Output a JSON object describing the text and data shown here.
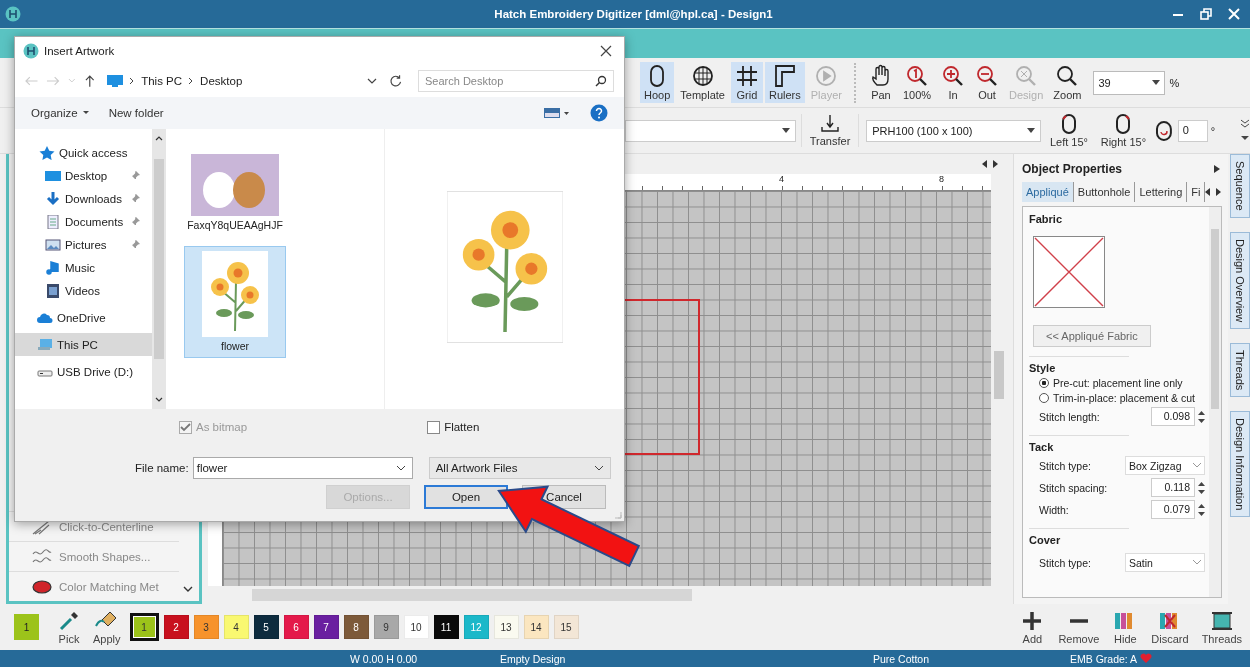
{
  "window": {
    "title": "Hatch Embroidery Digitizer [dml@hpl.ca] - Design1"
  },
  "toolbar": {
    "items": [
      {
        "kind": "hoop",
        "label": "Hoop",
        "selected": true,
        "disabled": false
      },
      {
        "kind": "template",
        "label": "Template",
        "selected": false,
        "disabled": false
      },
      {
        "kind": "grid",
        "label": "Grid",
        "selected": true,
        "disabled": false
      },
      {
        "kind": "rulers",
        "label": "Rulers",
        "selected": true,
        "disabled": false
      },
      {
        "kind": "player",
        "label": "Player",
        "selected": false,
        "disabled": true
      },
      {
        "kind": "pan",
        "label": "Pan",
        "selected": false,
        "disabled": false
      },
      {
        "kind": "zoom100",
        "label": "100%",
        "selected": false,
        "disabled": false
      },
      {
        "kind": "zoomin",
        "label": "In",
        "selected": false,
        "disabled": false
      },
      {
        "kind": "zoomout",
        "label": "Out",
        "selected": false,
        "disabled": false
      },
      {
        "kind": "zoomdesign",
        "label": "Design",
        "selected": false,
        "disabled": true
      },
      {
        "kind": "zoom",
        "label": "Zoom",
        "selected": false,
        "disabled": false
      }
    ],
    "zoom_value": "39",
    "zoom_unit": "%"
  },
  "hoop_bar": {
    "transfer": "Transfer",
    "hoop_size": "PRH100 (100 x 100)",
    "rotate_left": "Left 15°",
    "rotate_right": "Right 15°",
    "angle": "0",
    "angle_unit": "°"
  },
  "canvas": {
    "ruler_labels": [
      "4",
      "8"
    ]
  },
  "left_panel": {
    "items": [
      {
        "kind": "centerline",
        "label": "Click-to-Centerline"
      },
      {
        "kind": "smooth",
        "label": "Smooth Shapes..."
      },
      {
        "kind": "color",
        "label": "Color Matching Met"
      }
    ]
  },
  "object_properties": {
    "title": "Object Properties",
    "tabs": [
      {
        "label": "Appliqué",
        "selected": true
      },
      {
        "label": "Buttonhole",
        "selected": false
      },
      {
        "label": "Lettering",
        "selected": false
      },
      {
        "label": "Fi",
        "selected": false
      }
    ],
    "fabric": {
      "heading": "Fabric",
      "button": "<< Appliqué Fabric"
    },
    "style": {
      "heading": "Style",
      "options": [
        {
          "label": "Pre-cut: placement line only",
          "selected": true
        },
        {
          "label": "Trim-in-place: placement & cut",
          "selected": false
        }
      ],
      "stitch_length": {
        "label": "Stitch length:",
        "value": "0.098"
      }
    },
    "tack": {
      "heading": "Tack",
      "stitch_type": {
        "label": "Stitch type:",
        "value": "Box Zigzag"
      },
      "stitch_spacing": {
        "label": "Stitch spacing:",
        "value": "0.118"
      },
      "width": {
        "label": "Width:",
        "value": "0.079"
      }
    },
    "cover": {
      "heading": "Cover",
      "stitch_type": {
        "label": "Stitch type:",
        "value": "Satin"
      }
    }
  },
  "side_tabs": [
    "Sequence",
    "Design Overview",
    "Threads",
    "Design Information"
  ],
  "palette": {
    "current": {
      "label": "1",
      "color": "#9cc31a"
    },
    "tools": [
      "Pick",
      "Apply"
    ],
    "swatches": [
      {
        "label": "1",
        "color": "#9cc31a",
        "selected": true
      },
      {
        "label": "2",
        "color": "#c8101e",
        "selected": false
      },
      {
        "label": "3",
        "color": "#f7932b",
        "selected": false
      },
      {
        "label": "4",
        "color": "#f9f871",
        "selected": false
      },
      {
        "label": "5",
        "color": "#0d2b3e",
        "selected": false
      },
      {
        "label": "6",
        "color": "#e4194a",
        "selected": false
      },
      {
        "label": "7",
        "color": "#6a1fa0",
        "selected": false
      },
      {
        "label": "8",
        "color": "#7d5a3a",
        "selected": false
      },
      {
        "label": "9",
        "color": "#a8a8a8",
        "selected": false
      },
      {
        "label": "10",
        "color": "#ffffff",
        "selected": false
      },
      {
        "label": "11",
        "color": "#0a0a0a",
        "selected": false
      },
      {
        "label": "12",
        "color": "#1bb8c9",
        "selected": false
      },
      {
        "label": "13",
        "color": "#fafaf0",
        "selected": false
      },
      {
        "label": "14",
        "color": "#fbe6c0",
        "selected": false
      },
      {
        "label": "15",
        "color": "#f3e6d6",
        "selected": false
      }
    ],
    "thread_tools": [
      {
        "kind": "add",
        "label": "Add"
      },
      {
        "kind": "remove",
        "label": "Remove"
      },
      {
        "kind": "hide",
        "label": "Hide"
      },
      {
        "kind": "discard",
        "label": "Discard"
      },
      {
        "kind": "threads",
        "label": "Threads"
      }
    ]
  },
  "status_bar": [
    "W 0.00 H 0.00",
    "Empty Design",
    "Pure Cotton",
    "EMB Grade: A"
  ],
  "dialog": {
    "title": "Insert Artwork",
    "path": [
      "This PC",
      "Desktop"
    ],
    "search_placeholder": "Search Desktop",
    "organize": "Organize",
    "new_folder": "New folder",
    "nav": [
      {
        "kind": "star",
        "label": "Quick access",
        "pinned": false,
        "selected": false
      },
      {
        "kind": "desktop",
        "label": "Desktop",
        "pinned": true,
        "selected": false
      },
      {
        "kind": "download",
        "label": "Downloads",
        "pinned": true,
        "selected": false
      },
      {
        "kind": "document",
        "label": "Documents",
        "pinned": true,
        "selected": false
      },
      {
        "kind": "picture",
        "label": "Pictures",
        "pinned": true,
        "selected": false
      },
      {
        "kind": "music",
        "label": "Music",
        "pinned": false,
        "selected": false
      },
      {
        "kind": "video",
        "label": "Videos",
        "pinned": false,
        "selected": false
      },
      {
        "kind": "cloud",
        "label": "OneDrive",
        "pinned": false,
        "selected": false
      },
      {
        "kind": "pc",
        "label": "This PC",
        "pinned": false,
        "selected": true
      },
      {
        "kind": "drive",
        "label": "USB Drive (D:)",
        "pinned": false,
        "selected": false
      }
    ],
    "files": [
      {
        "kind": "bears",
        "name": "FaxqY8qUEAAgHJF",
        "selected": false
      },
      {
        "kind": "flower",
        "name": "flower",
        "selected": true
      }
    ],
    "options": [
      {
        "label": "As bitmap",
        "checked": true,
        "disabled": true
      },
      {
        "label": "Flatten",
        "checked": false,
        "disabled": false
      }
    ],
    "file_name": {
      "label": "File name:",
      "value": "flower"
    },
    "file_type": "All Artwork Files",
    "buttons": [
      {
        "label": "Options...",
        "disabled": true,
        "default": false
      },
      {
        "label": "Open",
        "disabled": false,
        "default": true
      },
      {
        "label": "Cancel",
        "disabled": false,
        "default": false
      }
    ]
  }
}
